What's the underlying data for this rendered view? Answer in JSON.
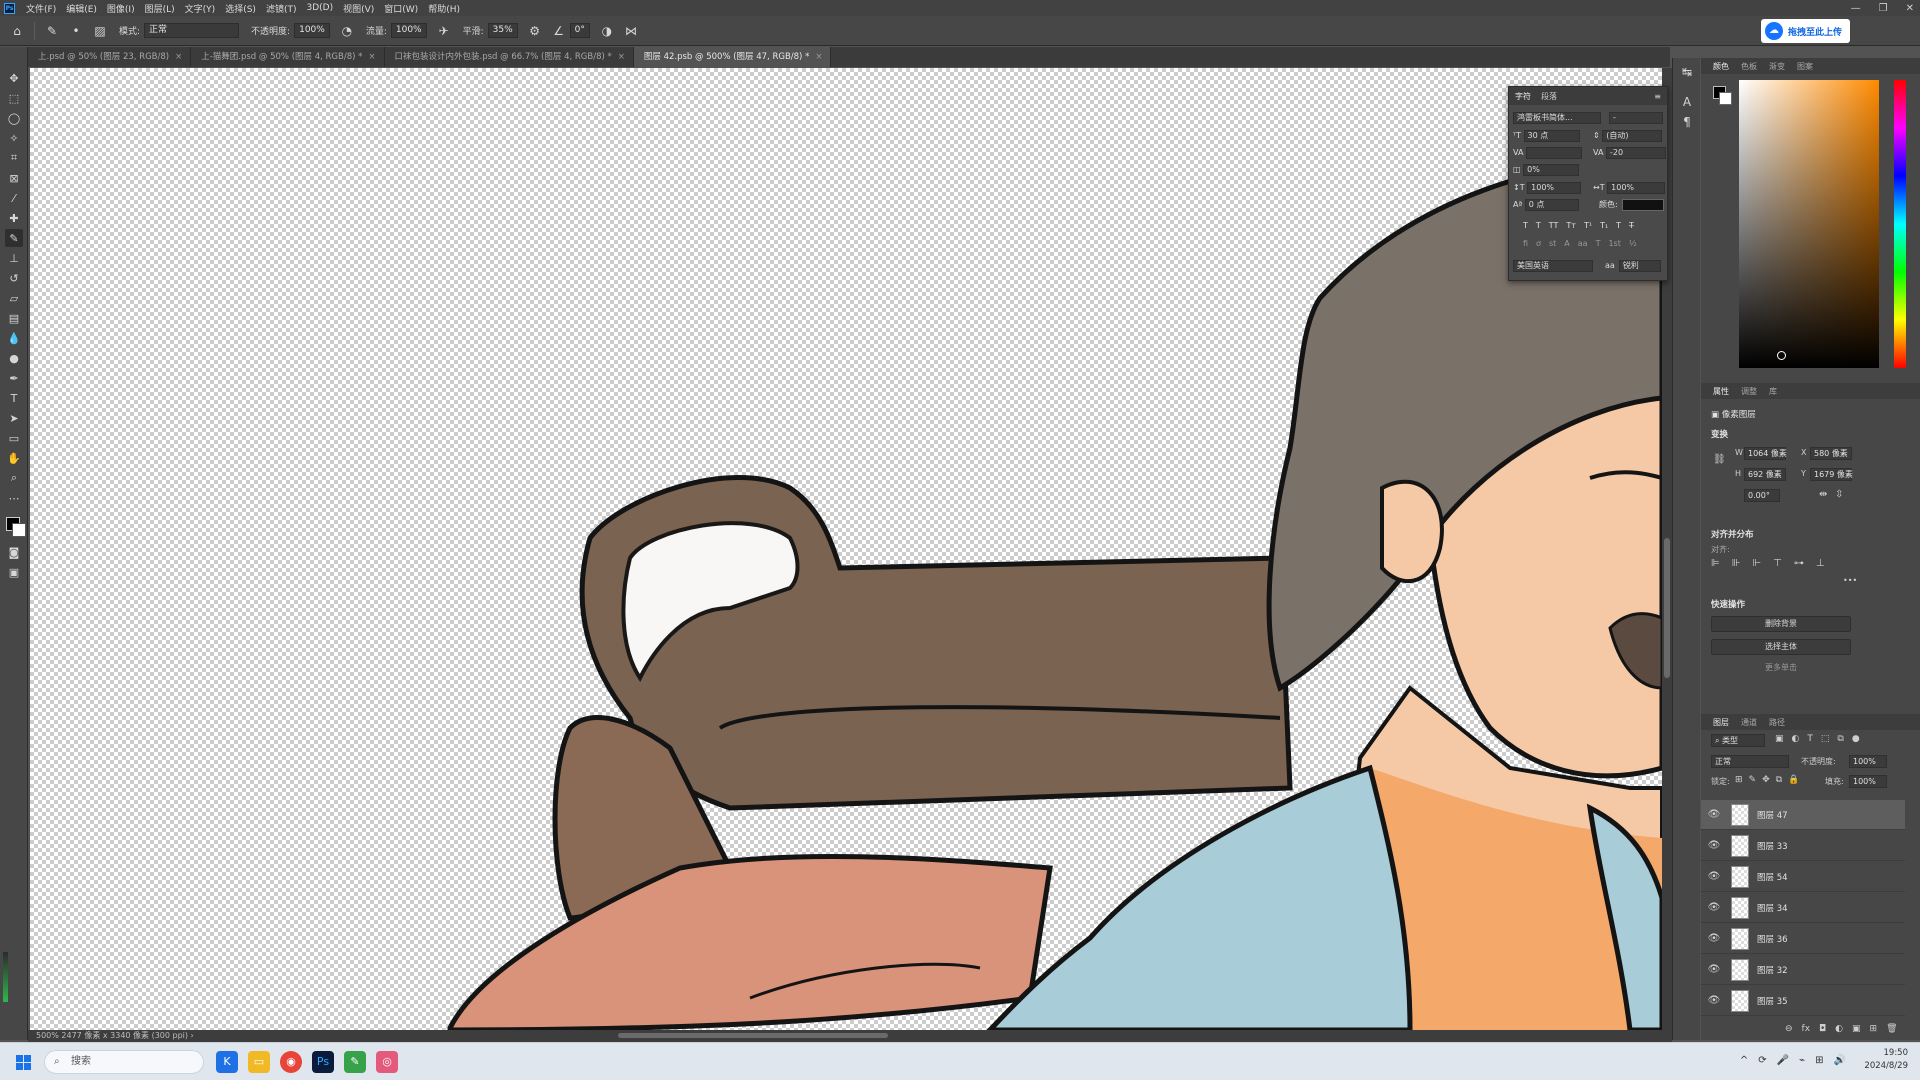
{
  "menubar": {
    "items": [
      "文件(F)",
      "编辑(E)",
      "图像(I)",
      "图层(L)",
      "文字(Y)",
      "选择(S)",
      "滤镜(T)",
      "3D(D)",
      "视图(V)",
      "窗口(W)",
      "帮助(H)"
    ],
    "ps_logo": "Ps",
    "window_controls": [
      "—",
      "❐",
      "✕"
    ]
  },
  "options": {
    "mode_label": "模式:",
    "mode_value": "正常",
    "opacity_label": "不透明度:",
    "opacity_value": "100%",
    "flow_label": "流量:",
    "flow_value": "100%",
    "smooth_label": "平滑:",
    "smooth_value": "35%",
    "angle_value": "0°",
    "upload_label": "拖拽至此上传"
  },
  "tabs": [
    {
      "label": "上.psd @ 50% (图层 23, RGB/8)",
      "close": "×"
    },
    {
      "label": "上-猫舞团.psd @ 50% (图层 4, RGB/8) *",
      "close": "×"
    },
    {
      "label": "口袜包装设计内外包装.psd @ 66.7% (图层 4, RGB/8) *",
      "close": "×"
    },
    {
      "label": "图层 42.psb @ 500% (图层 47, RGB/8) *",
      "close": "×"
    }
  ],
  "status": {
    "text": "500%    2477 像素 x 3340 像素 (300 ppi)   ›"
  },
  "character_panel": {
    "tab_character": "字符",
    "tab_paragraph": "段落",
    "font_family": "鸿雷板书简体...",
    "font_style": "-",
    "font_size": "30 点",
    "leading": "(自动)",
    "kerning": "",
    "tracking": "-20",
    "scale_pct": "0%",
    "vscale": "100%",
    "hscale": "100%",
    "baseline": "0 点",
    "color_label": "颜色:",
    "language": "美国英语",
    "aa_label": "aa",
    "aa_value": "锐利",
    "styles": [
      "T",
      "T",
      "TT",
      "Tт",
      "T¹",
      "T₁",
      "T",
      "T̶"
    ],
    "opentype": [
      "fi",
      "ơ",
      "st",
      "A",
      "aa",
      "T",
      "1st",
      "½"
    ]
  },
  "color_panel": {
    "tabs": [
      "颜色",
      "色板",
      "渐变",
      "图案"
    ],
    "fg_color": "#000000",
    "bg_color": "#ffffff",
    "hue_color": "#ff8a00"
  },
  "properties": {
    "tabs": [
      "属性",
      "调整",
      "库"
    ],
    "layer_type": "像素图层",
    "transform_title": "变换",
    "w": "1064 像素",
    "x": "580 像素",
    "h": "692 像素",
    "y": "1679 像素",
    "angle": "0.00°",
    "w_lbl": "W",
    "x_lbl": "X",
    "h_lbl": "H",
    "y_lbl": "Y",
    "align_title": "对齐并分布",
    "align_sub": "对齐:",
    "more": "•••",
    "quick_title": "快速操作",
    "remove_bg": "删除背景",
    "select_subject": "选择主体",
    "more_actions": "更多单击"
  },
  "layers": {
    "tabs": [
      "图层",
      "通道",
      "路径"
    ],
    "filter_label": "类型",
    "blend": "正常",
    "opacity_label": "不透明度:",
    "opacity": "100%",
    "lock_label": "锁定:",
    "fill_label": "填充:",
    "fill": "100%",
    "items": [
      {
        "name": "图层 47",
        "selected": true
      },
      {
        "name": "图层 33",
        "selected": false
      },
      {
        "name": "图层 54",
        "selected": false
      },
      {
        "name": "图层 34",
        "selected": false
      },
      {
        "name": "图层 36",
        "selected": false
      },
      {
        "name": "图层 32",
        "selected": false
      },
      {
        "name": "图层 35",
        "selected": false
      }
    ],
    "footer_icons": [
      "⊖",
      "fx",
      "◘",
      "◐",
      "▣",
      "⊞",
      "🗑"
    ]
  },
  "taskbar": {
    "search_placeholder": "搜索",
    "time": "19:50",
    "date": "2024/8/29",
    "tray": [
      "^",
      "⟳",
      "🎤",
      "⌁",
      "⊞",
      "🔊"
    ]
  }
}
